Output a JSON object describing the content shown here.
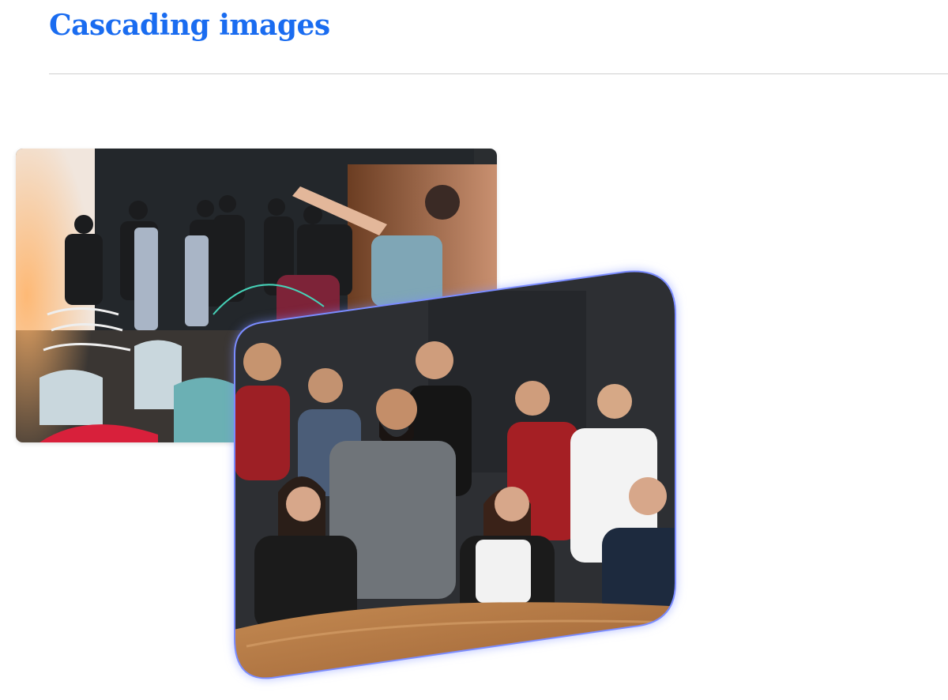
{
  "page": {
    "title": "Cascading images"
  },
  "images": [
    {
      "name": "team-event-photo",
      "description_icon": "photo-icon"
    },
    {
      "name": "team-group-photo",
      "description_icon": "photo-icon"
    }
  ],
  "colors": {
    "title": "#1a6cf0",
    "divider": "#cfcfcf",
    "glow": "#7b8cff",
    "wall_dark": "#2c2e32",
    "table_wood": "#b27a44"
  }
}
